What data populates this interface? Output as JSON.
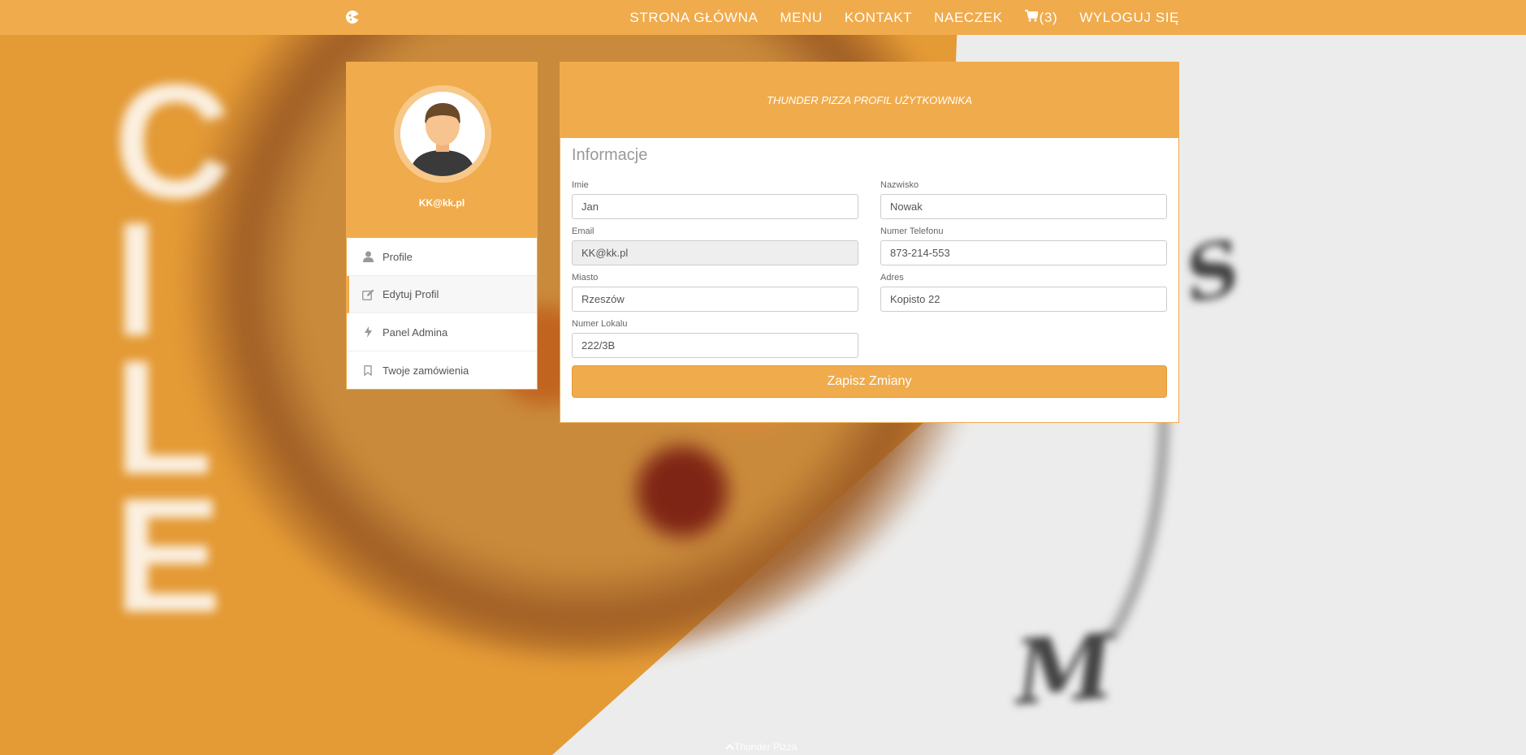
{
  "nav": {
    "brand_icon": "pizza-logo-icon",
    "links": [
      {
        "label": "STRONA GŁÓWNA"
      },
      {
        "label": "MENU"
      },
      {
        "label": "KONTAKT"
      },
      {
        "label": "NAECZEK"
      },
      {
        "label": "(3)",
        "icon": "cart-icon"
      },
      {
        "label": "WYLOGUJ SIĘ"
      }
    ]
  },
  "profile": {
    "email": "KK@kk.pl",
    "menu": [
      {
        "label": "Profile",
        "icon": "user-icon"
      },
      {
        "label": "Edytuj Profil",
        "icon": "edit-icon",
        "active": true
      },
      {
        "label": "Panel Admina",
        "icon": "bolt-icon"
      },
      {
        "label": "Twoje zamówienia",
        "icon": "bookmark-icon"
      }
    ]
  },
  "form": {
    "header": "THUNDER PIZZA PROFIL UŻYTKOWNIKA",
    "section_title": "Informacje",
    "fields": {
      "imie": {
        "label": "Imie",
        "value": "Jan"
      },
      "nazwisko": {
        "label": "Nazwisko",
        "value": "Nowak"
      },
      "email": {
        "label": "Email",
        "value": "KK@kk.pl"
      },
      "telefon": {
        "label": "Numer Telefonu",
        "value": "873-214-553"
      },
      "miasto": {
        "label": "Miasto",
        "value": "Rzeszów"
      },
      "adres": {
        "label": "Adres",
        "value": "Kopisto 22"
      },
      "lokal": {
        "label": "Numer Lokalu",
        "value": "222/3B"
      }
    },
    "save_label": "Zapisz Zmiany"
  },
  "footer": {
    "text": "Thunder Pizza",
    "icon": "chevron-up-icon"
  },
  "colors": {
    "accent": "#f0ab4c",
    "background_orange": "#e49a35"
  }
}
